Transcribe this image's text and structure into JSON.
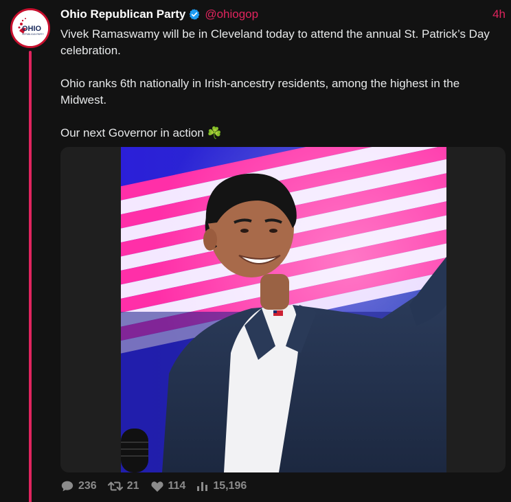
{
  "tweet": {
    "author_name": "Ohio Republican Party",
    "handle": "@ohiogop",
    "time": "4h",
    "avatar_text": "OHIO",
    "avatar_subtext": "REPUBLICAN PARTY",
    "paragraphs": [
      "Vivek Ramaswamy will be in Cleveland today to attend the annual St. Patrick’s Day celebration.",
      "Ohio ranks 6th nationally in Irish-ancestry residents, among the highest in the Midwest.",
      "Our next Governor in action ☘️"
    ],
    "stats": {
      "replies": "236",
      "retweets": "21",
      "likes": "114",
      "views": "15,196"
    }
  },
  "colors": {
    "accent": "#e0245e",
    "background": "#121212",
    "text": "#e7e9ea",
    "muted": "#8b8b8b",
    "verified": "#1d9bf0"
  },
  "icons": {
    "verified": "verified-badge-icon",
    "reply": "reply-icon",
    "retweet": "retweet-icon",
    "like": "heart-icon",
    "views": "views-bar-chart-icon"
  }
}
